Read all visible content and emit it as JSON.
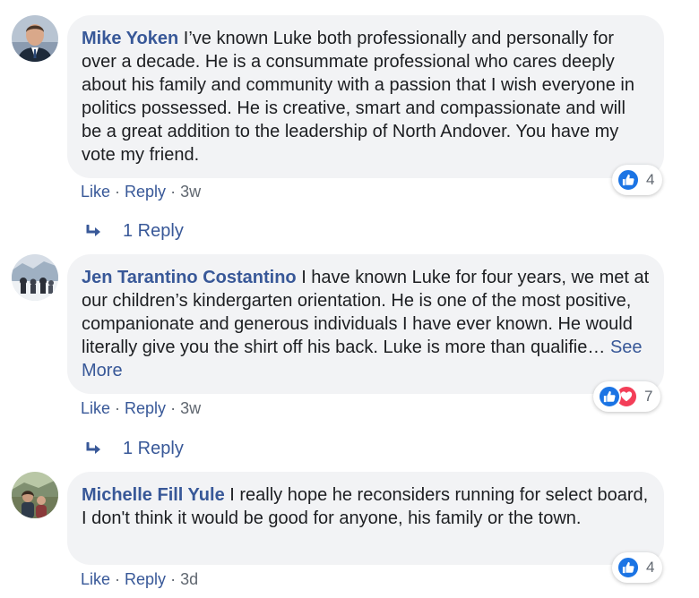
{
  "comments": [
    {
      "author": "Mike Yoken",
      "text": " I’ve known Luke both professionally and personally for over a decade. He is a consummate professional who cares deeply about his family and community with a passion that I wish everyone in politics possessed. He is creative, smart and compassionate and will be a great addition to the leadership of North Andover. You have my vote my friend.",
      "see_more": "",
      "like_label": "Like",
      "reply_label": "Reply",
      "time": "3w",
      "reaction_count": "4",
      "reactions": [
        "like-icon"
      ],
      "replies_label": "1 Reply"
    },
    {
      "author": "Jen Tarantino Costantino",
      "text": " I have known Luke for four years, we met at our children’s kindergarten orientation. He is one of the most positive, companionate and generous individuals I have ever known. He would literally give you the shirt off his back. Luke is more than qualifie…",
      "see_more": "See More",
      "like_label": "Like",
      "reply_label": "Reply",
      "time": "3w",
      "reaction_count": "7",
      "reactions": [
        "like-icon",
        "love-icon"
      ],
      "replies_label": "1 Reply"
    },
    {
      "author": "Michelle Fill Yule",
      "text": " I really hope he reconsiders running for select board, I don't think it would be good for anyone, his family or the town.",
      "see_more": "",
      "like_label": "Like",
      "reply_label": "Reply",
      "time": "3d",
      "reaction_count": "4",
      "reactions": [
        "like-icon"
      ]
    }
  ],
  "separator": " · ",
  "colors": {
    "link": "#385898",
    "bubble": "#f2f3f5",
    "like": "#1b74e4",
    "love": "#f33e58",
    "meta": "#606770"
  }
}
